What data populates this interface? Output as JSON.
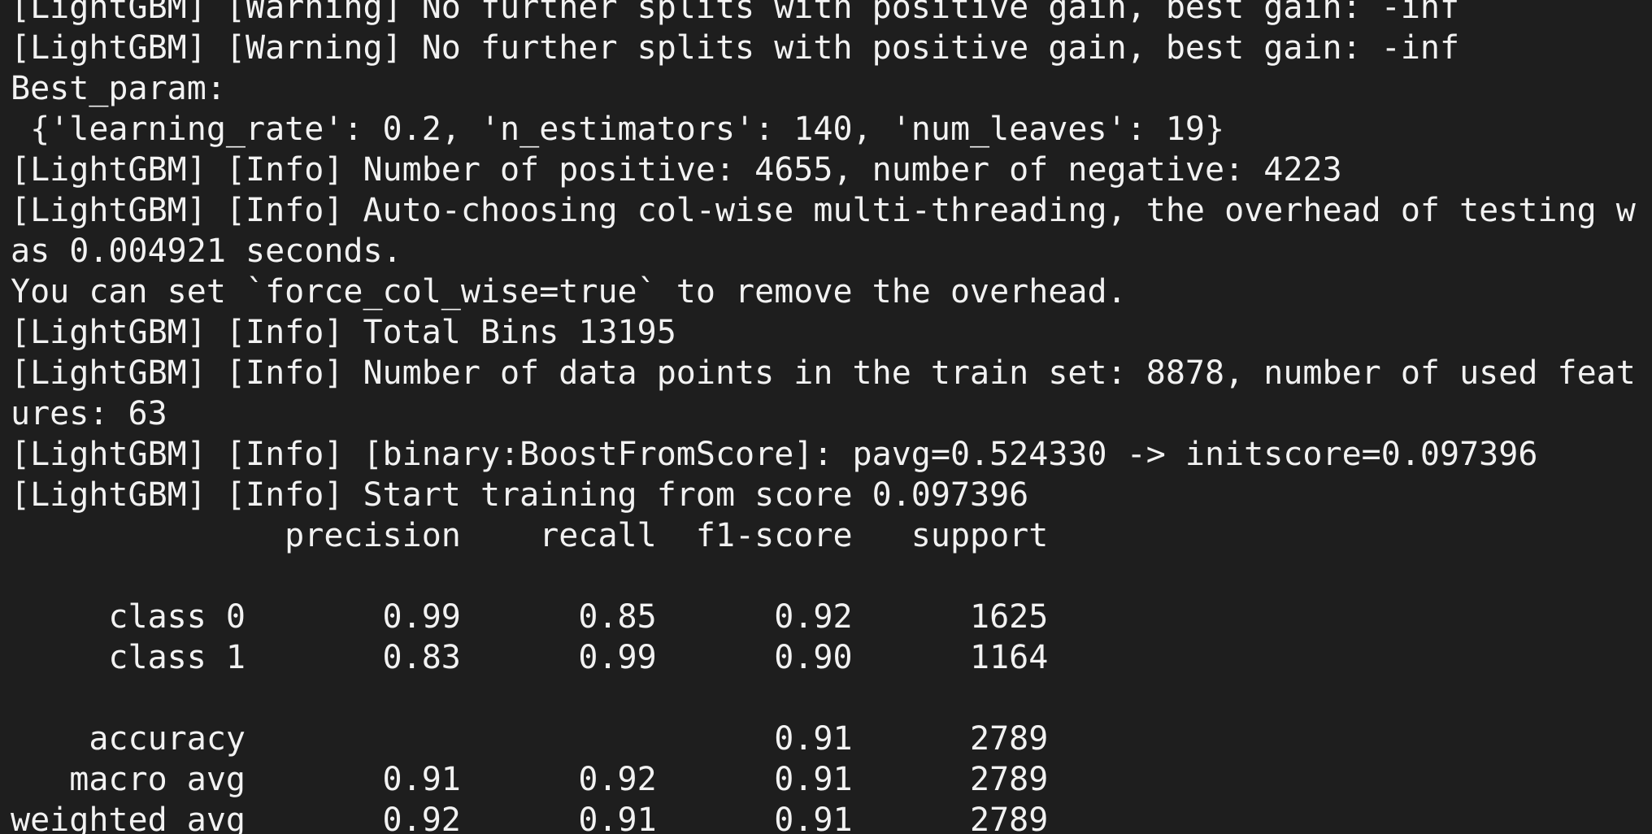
{
  "terminal": {
    "lines": [
      "[LightGBM] [Warning] No further splits with positive gain, best gain: -inf",
      "[LightGBM] [Warning] No further splits with positive gain, best gain: -inf",
      "Best_param:",
      " {'learning_rate': 0.2, 'n_estimators': 140, 'num_leaves': 19}",
      "[LightGBM] [Info] Number of positive: 4655, number of negative: 4223",
      "[LightGBM] [Info] Auto-choosing col-wise multi-threading, the overhead of testing w",
      "as 0.004921 seconds.",
      "You can set `force_col_wise=true` to remove the overhead.",
      "[LightGBM] [Info] Total Bins 13195",
      "[LightGBM] [Info] Number of data points in the train set: 8878, number of used feat",
      "ures: 63",
      "[LightGBM] [Info] [binary:BoostFromScore]: pavg=0.524330 -> initscore=0.097396",
      "[LightGBM] [Info] Start training from score 0.097396",
      "              precision    recall  f1-score   support",
      "",
      "     class 0       0.99      0.85      0.92      1625",
      "     class 1       0.83      0.99      0.90      1164",
      "",
      "    accuracy                           0.91      2789",
      "   macro avg       0.91      0.92      0.91      2789",
      "weighted avg       0.92      0.91      0.91      2789"
    ]
  }
}
